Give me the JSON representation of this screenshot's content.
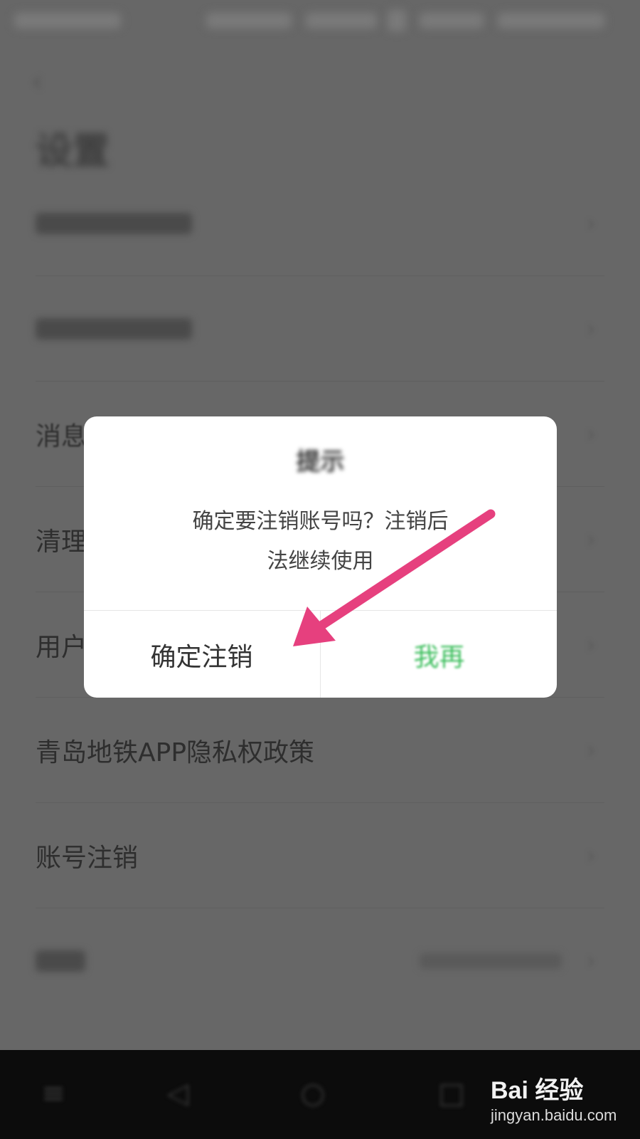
{
  "page": {
    "title": "设置"
  },
  "settings_list": [
    {
      "label": "消息"
    },
    {
      "label": "清理"
    },
    {
      "label": "用户"
    },
    {
      "label": "青岛地铁APP隐私权政策"
    },
    {
      "label": "账号注销"
    }
  ],
  "dialog": {
    "title": "提示",
    "message_line1": "确定要注销账号吗？注销后",
    "message_line2": "法继续使用",
    "confirm_label": "确定注销",
    "cancel_label": "我再"
  },
  "watermark": {
    "brand": "Bai 经验",
    "url": "jingyan.baidu.com"
  },
  "colors": {
    "overlay": "#676767",
    "cancel_green": "#3fbf5f",
    "arrow_pink": "#e6407e",
    "nav_bar": "#0c0c0c"
  },
  "icons": [
    "back-arrow-icon",
    "chevron-right-icon",
    "annotation-arrow-icon",
    "baidu-paw-icon"
  ]
}
